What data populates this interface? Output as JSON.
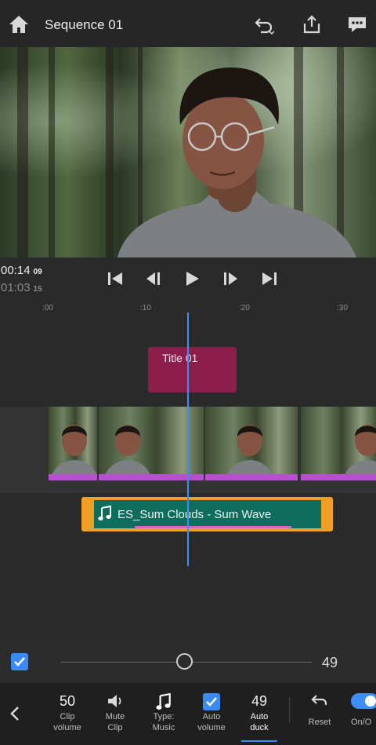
{
  "header": {
    "title": "Sequence 01"
  },
  "timecode": {
    "current": "00:14",
    "current_frames": "09",
    "duration": "01:03",
    "duration_frames": "15"
  },
  "ruler": {
    "ticks": [
      ":00",
      ":10",
      ":20",
      ":30"
    ]
  },
  "timeline": {
    "title_clip": "Title 01",
    "audio_clip": "ES_Sum Clouds - Sum Wave"
  },
  "volume": {
    "value": "49",
    "level_percent": 49,
    "checked": true
  },
  "toolbar": {
    "clip_volume_value": "50",
    "clip_volume_label": [
      "Clip",
      "volume"
    ],
    "mute_label": [
      "Mute",
      "Clip"
    ],
    "type_label": [
      "Type:",
      "Music"
    ],
    "auto_volume_label": [
      "Auto",
      "volume"
    ],
    "auto_duck_value": "49",
    "auto_duck_label": [
      "Auto",
      "duck"
    ],
    "reset_label": "Reset",
    "onoff_label": "On/O"
  },
  "colors": {
    "accent": "#3e8ef7",
    "title_clip": "#8c1e4c",
    "audio_clip_border": "#f0a125",
    "audio_clip_fill": "#0f6d5d",
    "video_clip_bar": "#b84fd0"
  }
}
